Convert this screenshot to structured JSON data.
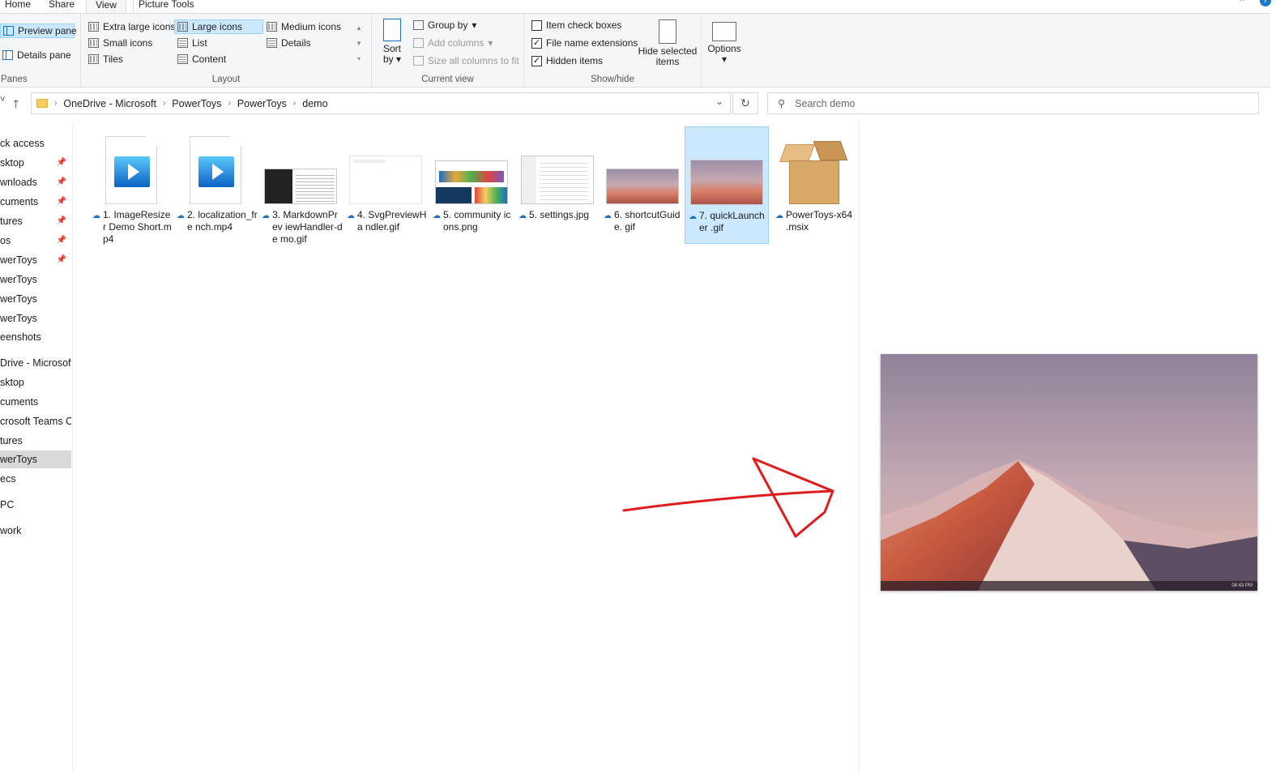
{
  "tabs": {
    "home": "Home",
    "share": "Share",
    "view": "View",
    "picture_tools": "Picture Tools"
  },
  "ribbon": {
    "panes": {
      "preview_pane": "Preview pane",
      "details_pane": "Details pane",
      "label": "Panes"
    },
    "layout": {
      "extra_large": "Extra large icons",
      "large": "Large icons",
      "medium": "Medium icons",
      "small": "Small icons",
      "list": "List",
      "details": "Details",
      "tiles": "Tiles",
      "content": "Content",
      "label": "Layout"
    },
    "current_view": {
      "sort_by_1": "Sort",
      "sort_by_2": "by",
      "group_by": "Group by",
      "add_columns": "Add columns",
      "size_columns": "Size all columns to fit",
      "label": "Current view"
    },
    "show_hide": {
      "item_check_boxes": "Item check boxes",
      "file_name_extensions": "File name extensions",
      "hidden_items": "Hidden items",
      "hide_selected_1": "Hide selected",
      "hide_selected_2": "items",
      "label": "Show/hide"
    },
    "options": "Options"
  },
  "address": {
    "crumbs": [
      "OneDrive - Microsoft",
      "PowerToys",
      "PowerToys",
      "demo"
    ]
  },
  "search": {
    "placeholder": "Search demo"
  },
  "sidebar": {
    "items": [
      "ck access",
      "sktop",
      "wnloads",
      "cuments",
      "tures",
      "os",
      "werToys",
      "werToys",
      "werToys",
      "werToys",
      "eenshots",
      "Drive - Microsoft",
      "sktop",
      "cuments",
      "crosoft Teams Ch",
      "tures",
      "werToys",
      "ecs",
      "PC",
      "work"
    ]
  },
  "files": [
    {
      "name": "1. ImageResizer Demo Short.mp4"
    },
    {
      "name": "2. localization_fre nch.mp4"
    },
    {
      "name": "3. MarkdownPrev iewHandler-de mo.gif"
    },
    {
      "name": "4. SvgPreviewHa ndler.gif"
    },
    {
      "name": "5. community icons.png"
    },
    {
      "name": "5. settings.jpg"
    },
    {
      "name": "6. shortcutGuide. gif"
    },
    {
      "name": "7. quickLauncher .gif"
    },
    {
      "name": "PowerToys-x64 .msix"
    }
  ],
  "preview": {
    "taskbar_time": "08:43 PM"
  }
}
